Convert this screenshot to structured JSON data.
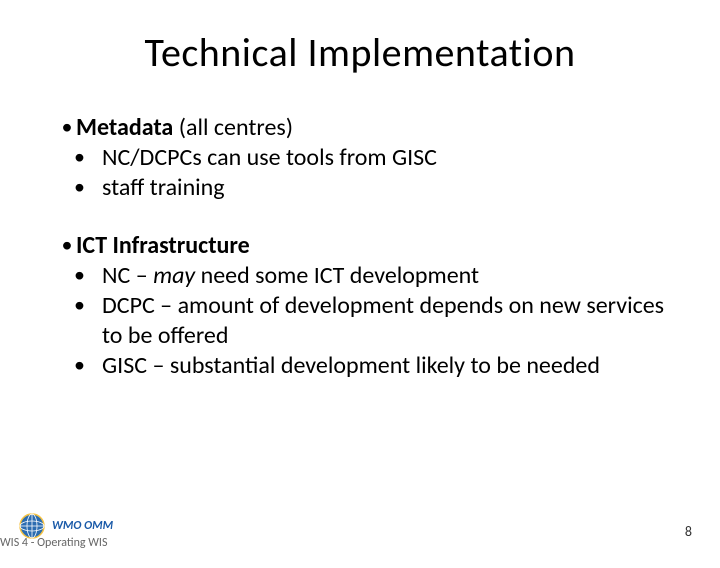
{
  "title": "Technical Implementation",
  "groups": [
    {
      "heading_bold": "Metadata",
      "heading_rest": " (all centres)",
      "items": [
        {
          "text": "NC/DCPCs can use tools from GISC"
        },
        {
          "text": "staff training"
        }
      ]
    },
    {
      "heading_bold": "ICT Infrastructure",
      "heading_rest": "",
      "items": [
        {
          "prefix": "NC – ",
          "italic": "may",
          "suffix": " need some ICT development"
        },
        {
          "text": "DCPC – amount of development depends on new services to be offered"
        },
        {
          "text": "GISC – substantial development likely to be needed"
        }
      ]
    }
  ],
  "footer": {
    "label": "WIS 4 - Operating WIS",
    "logo_text": "WMO OMM",
    "page_number": "8"
  }
}
